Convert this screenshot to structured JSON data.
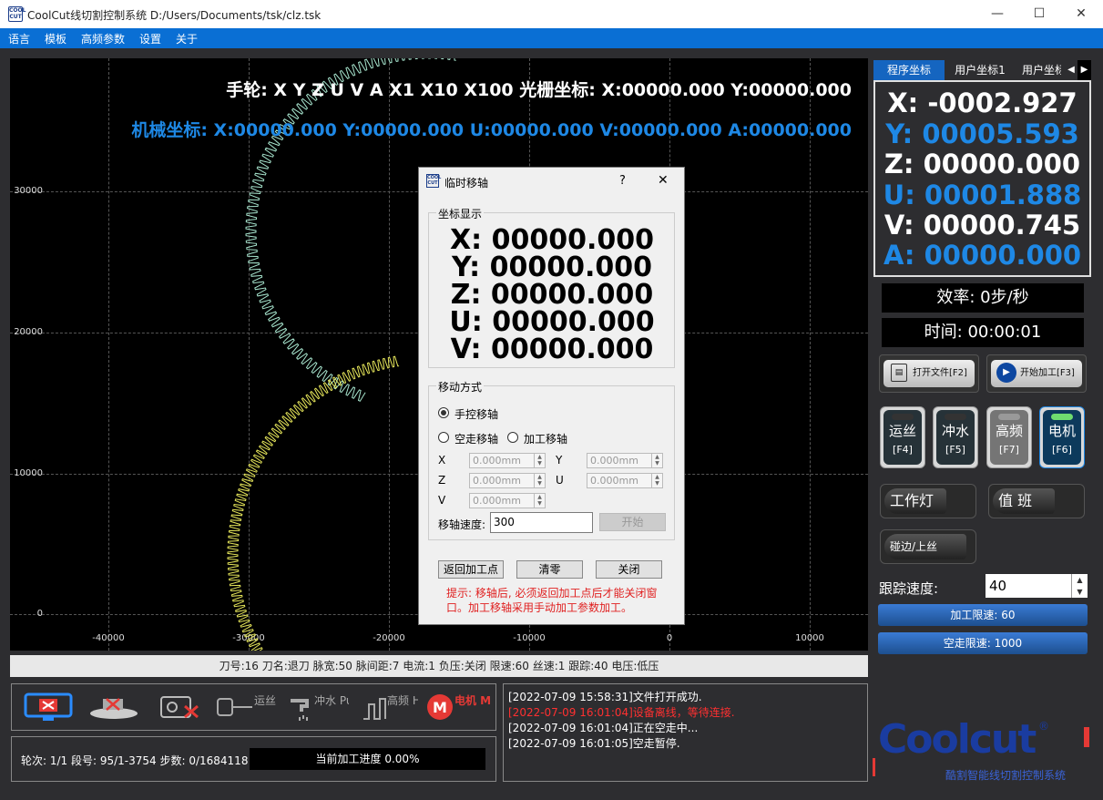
{
  "window": {
    "logo_text": "COOL CUT",
    "title": "CoolCut线切割控制系统 D:/Users/Documents/tsk/clz.tsk",
    "minimize": "—",
    "maximize": "☐",
    "close": "✕"
  },
  "menu": {
    "items": [
      "语言",
      "模板",
      "高频参数",
      "设置",
      "关于"
    ]
  },
  "canvas": {
    "handwheel": "手轮:  X  Y  Z  U  V  A  X1 X10 X100  光栅坐标:  X:00000.000 Y:00000.000",
    "machine_coords": "机械坐标:  X:00000.000 Y:00000.000 U:00000.000 V:00000.000 A:00000.000",
    "y_ticks": [
      "30000",
      "20000",
      "10000",
      "0"
    ],
    "x_ticks": [
      "-40000",
      "-30000",
      "-20000",
      "-10000",
      "0",
      "10000"
    ],
    "gear_colors": {
      "upper": "#a8e6cf",
      "lower": "#e6e65a"
    }
  },
  "status_line": "刀号:16 刀名:退刀 脉宽:50 脉间距:7 电流:1 负压:关闭 限速:60 丝速:1 跟踪:40 电压:低压",
  "icons": [
    {
      "name": "screen-off-icon",
      "label": ""
    },
    {
      "name": "machine-icon",
      "label": ""
    },
    {
      "name": "control-box-icon",
      "label": ""
    },
    {
      "name": "wire-icon",
      "label": "运丝 Wire"
    },
    {
      "name": "pump-icon",
      "label": "冲水 Pump"
    },
    {
      "name": "hf-icon",
      "label": "高频 HF"
    },
    {
      "name": "motor-icon",
      "label": "电机 Motor"
    }
  ],
  "progress": {
    "round_info": "轮次: 1/1  段号: 95/1-3754  步数: 0/1684118",
    "label": "当前加工进度 0.00%",
    "fraction": 0.0
  },
  "log": [
    {
      "text": "[2022-07-09 15:58:31]文件打开成功.",
      "color": "#ffffff"
    },
    {
      "text": "[2022-07-09 16:01:04]设备离线，等待连接.",
      "color": "#ff3030"
    },
    {
      "text": "[2022-07-09 16:01:04]正在空走中...",
      "color": "#ffffff"
    },
    {
      "text": "[2022-07-09 16:01:05]空走暂停.",
      "color": "#ffffff"
    }
  ],
  "coord_tabs": [
    "程序坐标",
    "用户坐标1",
    "用户坐标"
  ],
  "coords": [
    {
      "text": "X: -0002.927",
      "color": "#ffffff"
    },
    {
      "text": "Y: 00005.593",
      "color": "#1e88e5"
    },
    {
      "text": "Z: 00000.000",
      "color": "#ffffff"
    },
    {
      "text": "U: 00001.888",
      "color": "#1e88e5"
    },
    {
      "text": "V: 00000.745",
      "color": "#ffffff"
    },
    {
      "text": "A: 00000.000",
      "color": "#1e88e5"
    }
  ],
  "efficiency": "效率:  0步/秒",
  "time": "时间:  00:00:01",
  "buttons": {
    "open_file": "打开文件[F2]",
    "start": "开始加工[F3]",
    "wire": {
      "label": "运丝",
      "key": "[F4]"
    },
    "pump": {
      "label": "冲水",
      "key": "[F5]"
    },
    "hf": {
      "label": "高频",
      "key": "[F7]"
    },
    "motor": {
      "label": "电机",
      "key": "[F6]"
    },
    "work_light": "工作灯",
    "duty": "值 班",
    "edge": "碰边/上丝"
  },
  "tracking": {
    "label": "跟踪速度:",
    "value": "40"
  },
  "limits": {
    "process": "加工限速:  60",
    "idle": "空走限速:  1000"
  },
  "brand": {
    "logo": "Coolcut",
    "registered": "®",
    "subtitle": "酷割智能线切割控制系统"
  },
  "dialog": {
    "logo_text": "COOL CUT",
    "title": "临时移轴",
    "help": "?",
    "close": "✕",
    "coord_group": "坐标显示",
    "coords": [
      "X: 00000.000",
      "Y: 00000.000",
      "Z: 00000.000",
      "U: 00000.000",
      "V: 00000.000"
    ],
    "move_group": "移动方式",
    "manual": "手控移轴",
    "idle_move": "空走移轴",
    "process_move": "加工移轴",
    "axes": {
      "x": "X",
      "y": "Y",
      "z": "Z",
      "u": "U",
      "v": "V"
    },
    "axis_value": "0.000mm",
    "speed_label": "移轴速度:",
    "speed_value": "300",
    "start": "开始",
    "return": "返回加工点",
    "clear": "清零",
    "close_btn": "关闭",
    "hint": "提示: 移轴后, 必须返回加工点后才能关闭窗口。加工移轴采用手动加工参数加工。"
  }
}
